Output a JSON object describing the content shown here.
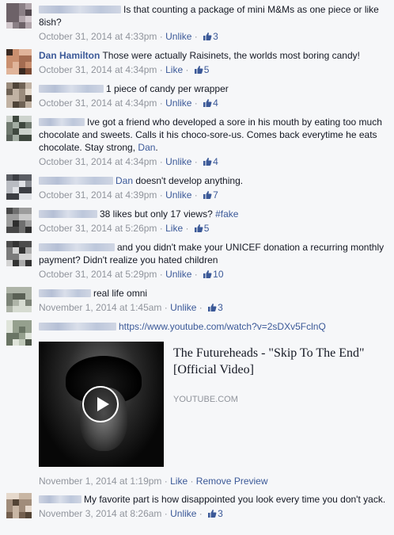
{
  "comments": [
    {
      "name": "",
      "text": "Is that counting a package of mini M&Ms as one piece or like 8ish?",
      "date": "October 31, 2014 at 4:33pm",
      "action": "Unlike",
      "likes": "3"
    },
    {
      "name": "Dan Hamilton",
      "text": "Those were actually Raisinets, the worlds most boring candy!",
      "date": "October 31, 2014 at 4:34pm",
      "action": "Like",
      "likes": "5"
    },
    {
      "name": "",
      "text": "1 piece of candy per wrapper",
      "date": "October 31, 2014 at 4:34pm",
      "action": "Unlike",
      "likes": "4"
    },
    {
      "name": "",
      "text": "Ive got a friend who developed a sore in his mouth by eating too much chocolate and sweets. Calls it his choco-sore-us. Comes back everytime he eats chocolate. Stay strong, ",
      "mention": "Dan",
      "text_end": ".",
      "date": "October 31, 2014 at 4:34pm",
      "action": "Unlike",
      "likes": "4"
    },
    {
      "name": "",
      "mention": "Dan",
      "text": " doesn't develop anything.",
      "date": "October 31, 2014 at 4:39pm",
      "action": "Unlike",
      "likes": "7"
    },
    {
      "name": "",
      "text": "38 likes but only 17 views? ",
      "hashtag": "#fake",
      "date": "October 31, 2014 at 5:26pm",
      "action": "Like",
      "likes": "5"
    },
    {
      "name": "",
      "text": "and you didn't make your UNICEF donation a recurring monthly payment? Didn't realize you hated children",
      "date": "October 31, 2014 at 5:29pm",
      "action": "Unlike",
      "likes": "10"
    },
    {
      "name": "",
      "text": "real life omni",
      "date": "November 1, 2014 at 1:45am",
      "action": "Unlike",
      "likes": "3"
    },
    {
      "name": "",
      "link": "https://www.youtube.com/watch?v=2sDXv5FclnQ",
      "date": "November 1, 2014 at 1:19pm",
      "action": "Like",
      "extra": "Remove Preview"
    },
    {
      "name": "",
      "text": "My favorite part is how disappointed you look every time you don't yack.",
      "date": "November 3, 2014 at 8:26am",
      "action": "Unlike",
      "likes": "3"
    }
  ],
  "preview": {
    "title": "The Futureheads - \"Skip To The End\" [Official Video]",
    "domain": "YOUTUBE.COM"
  },
  "meta_separator": " · ",
  "colors": {
    "link": "#3b5998",
    "meta": "#90949c",
    "text": "#141823",
    "background": "#f6f7f9"
  },
  "icons": {
    "like": "thumbs-up-icon",
    "play": "play-icon"
  }
}
